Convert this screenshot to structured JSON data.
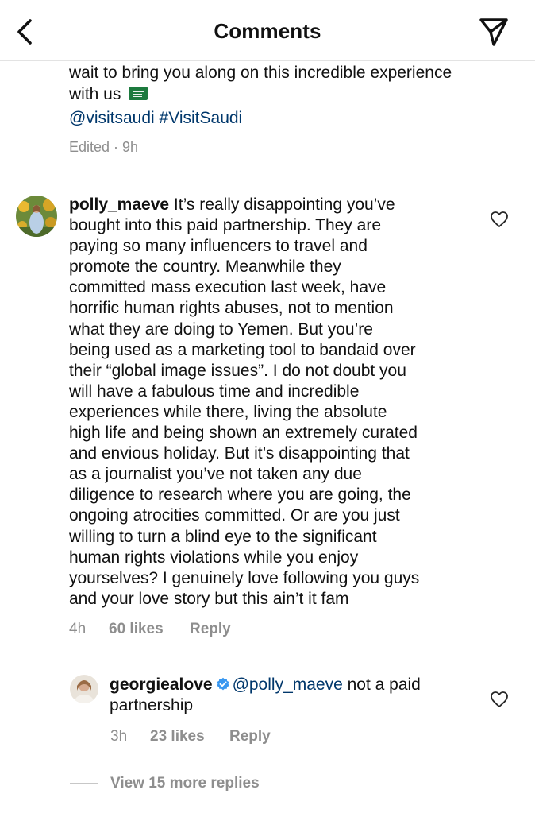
{
  "header": {
    "title": "Comments",
    "back_icon": "chevron-left-icon",
    "send_icon": "paper-plane-icon"
  },
  "caption": {
    "line1": "wait to bring you along on this incredible experience",
    "line2": "with us",
    "flag_icon": "saudi-flag-icon",
    "mention": "@visitsaudi",
    "hashtag": "#VisitSaudi",
    "meta": "Edited · 9h"
  },
  "comment": {
    "username": "polly_maeve",
    "lines": [
      "It’s really disappointing you’ve",
      "bought into this paid partnership. They are",
      "paying so many influencers to travel and",
      "promote the country. Meanwhile they",
      "committed mass execution last week, have",
      "horrific human rights abuses, not to mention",
      "what they are doing to Yemen. But you’re",
      "being used as a marketing tool to bandaid over",
      "their “global image issues”. I do not doubt you",
      "will have a fabulous time and incredible",
      "experiences while there, living the absolute",
      "high life and being shown an extremely curated",
      "and envious holiday. But it’s disappointing that",
      "as a journalist you’ve not taken any due",
      "diligence to research where you are going, the",
      "ongoing atrocities committed. Or are you just",
      "willing to turn a blind eye to the significant",
      "human rights violations while you enjoy",
      "yourselves? I genuinely love following you guys",
      "and your love story but this ain’t it fam"
    ],
    "time": "4h",
    "likes": "60 likes",
    "reply": "Reply"
  },
  "reply_comment": {
    "username": "georgiealove",
    "mention": "@polly_maeve",
    "text_rest": " not a paid",
    "text_line2": "partnership",
    "time": "3h",
    "likes": "23 likes",
    "reply": "Reply"
  },
  "view_more": "View 15 more replies",
  "colors": {
    "link": "#00376b",
    "muted": "#8e8e8e",
    "verified": "#3897f0"
  }
}
